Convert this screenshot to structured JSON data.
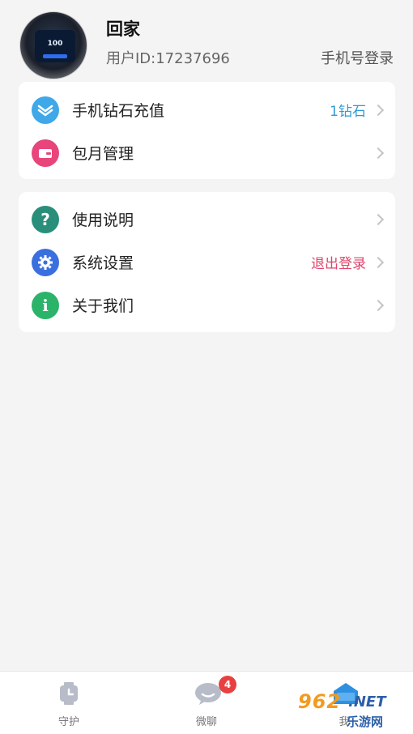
{
  "profile": {
    "name": "回家",
    "user_id": "用户ID:17237696",
    "phone_login": "手机号登录",
    "avatar_screen_text": "100"
  },
  "menu_card1": [
    {
      "label": "手机钻石充值",
      "value": "1钻石",
      "value_color": "#2f9bd6",
      "icon": "diamond-icon",
      "icon_color": "#3fa8e8"
    },
    {
      "label": "包月管理",
      "value": "",
      "icon": "wallet-icon",
      "icon_color": "#e8457a"
    }
  ],
  "menu_card2": [
    {
      "label": "使用说明",
      "value": "",
      "icon": "question-icon",
      "icon_color": "#2a8f7a"
    },
    {
      "label": "系统设置",
      "value": "退出登录",
      "value_color": "#e0456a",
      "icon": "gear-icon",
      "icon_color": "#3a6fe0"
    },
    {
      "label": "关于我们",
      "value": "",
      "icon": "info-icon",
      "icon_color": "#2bb36a"
    }
  ],
  "bottom_nav": {
    "tabs": [
      {
        "label": "守护",
        "icon": "watch-icon"
      },
      {
        "label": "微聊",
        "icon": "chat-icon",
        "badge": "4"
      },
      {
        "label": "我",
        "icon": "home-icon"
      }
    ]
  },
  "watermark": {
    "main": "962",
    "net": ".NET",
    "sub": "乐游网"
  }
}
